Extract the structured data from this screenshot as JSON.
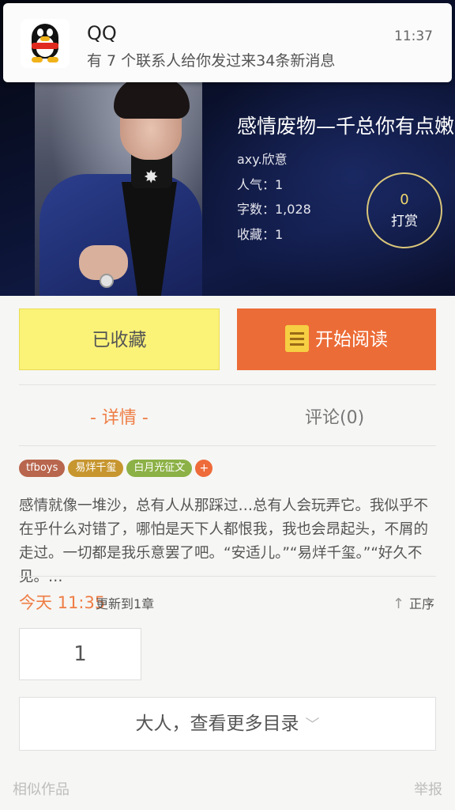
{
  "notification": {
    "app": "QQ",
    "message": "有 7 个联系人给你发过来34条新消息",
    "time": "11:37"
  },
  "book": {
    "title": "感情废物—千总你有点嫩",
    "author": "axy.欣意",
    "popularity": "人气：1",
    "word_count": "字数：1,028",
    "favorites": "收藏：1",
    "reward_count": "0",
    "reward_label": "打赏"
  },
  "actions": {
    "favorited_label": "已收藏",
    "start_reading_label": "开始阅读"
  },
  "tabs": {
    "detail": "- 详情 -",
    "comments": "评论(0)"
  },
  "tags": [
    {
      "label": "tfboys",
      "color": "#b8664d"
    },
    {
      "label": "易烊千玺",
      "color": "#c7962f"
    },
    {
      "label": "白月光征文",
      "color": "#8cb146"
    }
  ],
  "tag_add": "+",
  "description": "感情就像一堆沙，总有人从那踩过…总有人会玩弄它。我似乎不在乎什么对错了，哪怕是天下人都恨我，我也会昂起头，不屑的走过。一切都是我乐意罢了吧。“安适儿。”“易烊千玺。”“好久不见。…",
  "update": {
    "time": "今天 11:35",
    "text": "更新到1章",
    "sort_label": "正序"
  },
  "chapter": {
    "number": "1"
  },
  "more_catalog": "大人，查看更多目录",
  "footer": {
    "similar": "相似作品",
    "report": "举报"
  },
  "colors": {
    "accent_orange": "#ec6c37",
    "fav_yellow": "#fbf278"
  }
}
